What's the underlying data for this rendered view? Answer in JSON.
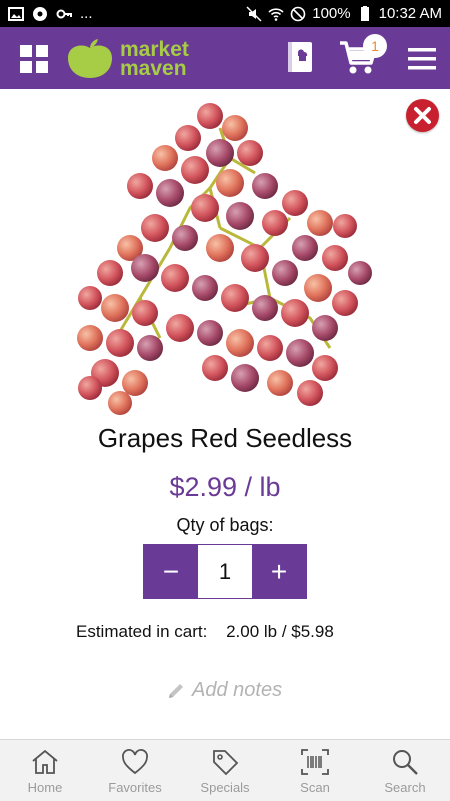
{
  "status_bar": {
    "notification_dots": "...",
    "battery": "100%",
    "time": "10:32 AM"
  },
  "header": {
    "logo_line1": "market",
    "logo_line2": "maven",
    "cart_count": "1"
  },
  "product": {
    "name": "Grapes Red Seedless",
    "price": "$2.99 / lb",
    "qty_label": "Qty of bags:",
    "qty_value": "1",
    "decrement": "−",
    "increment": "+",
    "estimate_label": "Estimated in cart:",
    "estimate_value": "2.00 lb / $5.98",
    "notes_label": "Add notes"
  },
  "nav": [
    {
      "label": "Home",
      "icon": "home-icon"
    },
    {
      "label": "Favorites",
      "icon": "heart-icon"
    },
    {
      "label": "Specials",
      "icon": "tag-icon"
    },
    {
      "label": "Scan",
      "icon": "barcode-icon"
    },
    {
      "label": "Search",
      "icon": "search-icon"
    }
  ],
  "colors": {
    "brand_purple": "#6a3a97",
    "brand_green": "#a7cc45",
    "close_red": "#c8202f",
    "badge_orange": "#e98a33"
  }
}
